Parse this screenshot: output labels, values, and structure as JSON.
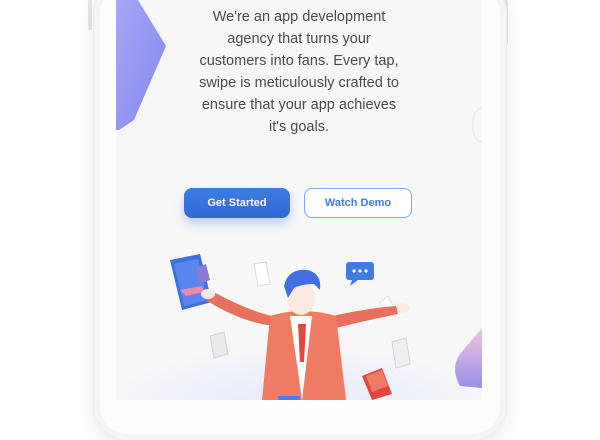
{
  "hero": {
    "lines": [
      "We're an app development",
      "agency that turns your",
      "customers into fans. Every tap,",
      "swipe is meticulously crafted to",
      "ensure that your app achieves",
      "it's goals."
    ]
  },
  "buttons": {
    "primary_label": "Get Started",
    "secondary_label": "Watch Demo"
  },
  "colors": {
    "accent": "#3f7be3",
    "text": "#4a4a4f",
    "background": "#f7f7f8"
  },
  "icons": [
    "chat-bubble-icon",
    "tablet-icon",
    "paper-icon",
    "book-icon"
  ]
}
